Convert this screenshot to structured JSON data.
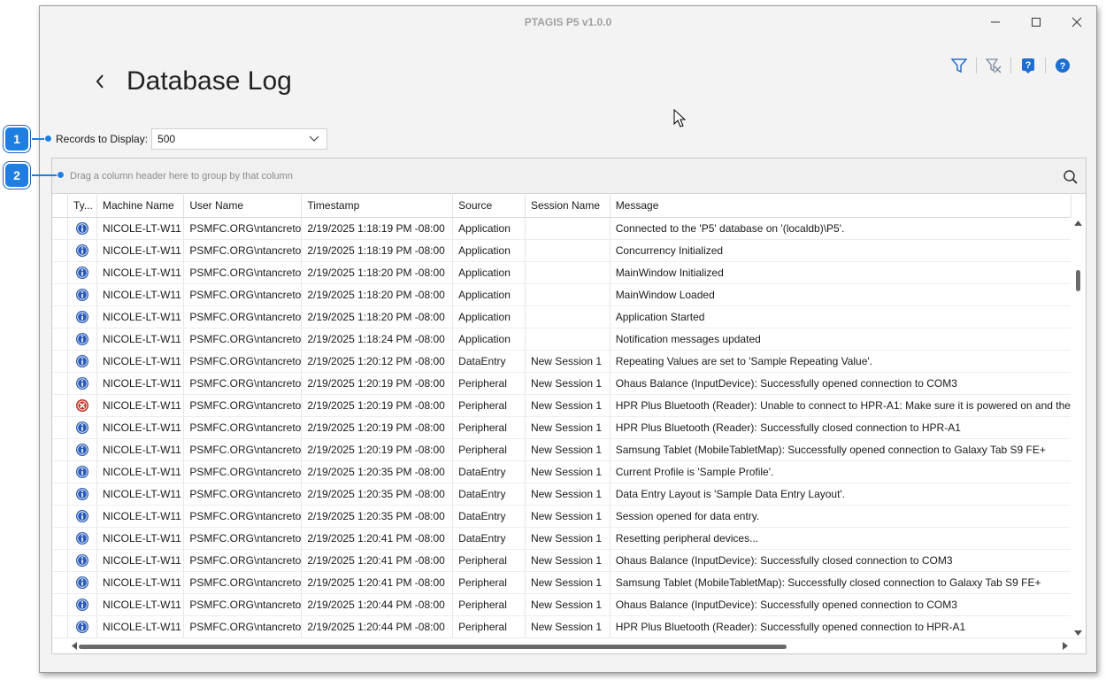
{
  "window": {
    "title": "PTAGIS P5 v1.0.0"
  },
  "page": {
    "title": "Database Log"
  },
  "records": {
    "label": "Records to Display:",
    "value": "500"
  },
  "grid": {
    "group_panel_text": "Drag a column header here to group by that column",
    "columns": [
      "Ty...",
      "Machine Name",
      "User Name",
      "Timestamp",
      "Source",
      "Session Name",
      "Message"
    ],
    "rows": [
      {
        "type": "info",
        "machine": "NICOLE-LT-W11",
        "user": "PSMFC.ORG\\ntancreto",
        "timestamp": "2/19/2025 1:18:19 PM -08:00",
        "source": "Application",
        "session": "",
        "message": "Connected to the 'P5' database on '(localdb)\\P5'."
      },
      {
        "type": "info",
        "machine": "NICOLE-LT-W11",
        "user": "PSMFC.ORG\\ntancreto",
        "timestamp": "2/19/2025 1:18:19 PM -08:00",
        "source": "Application",
        "session": "",
        "message": "Concurrency Initialized"
      },
      {
        "type": "info",
        "machine": "NICOLE-LT-W11",
        "user": "PSMFC.ORG\\ntancreto",
        "timestamp": "2/19/2025 1:18:20 PM -08:00",
        "source": "Application",
        "session": "",
        "message": "MainWindow Initialized"
      },
      {
        "type": "info",
        "machine": "NICOLE-LT-W11",
        "user": "PSMFC.ORG\\ntancreto",
        "timestamp": "2/19/2025 1:18:20 PM -08:00",
        "source": "Application",
        "session": "",
        "message": "MainWindow Loaded"
      },
      {
        "type": "info",
        "machine": "NICOLE-LT-W11",
        "user": "PSMFC.ORG\\ntancreto",
        "timestamp": "2/19/2025 1:18:20 PM -08:00",
        "source": "Application",
        "session": "",
        "message": "Application Started"
      },
      {
        "type": "info",
        "machine": "NICOLE-LT-W11",
        "user": "PSMFC.ORG\\ntancreto",
        "timestamp": "2/19/2025 1:18:24 PM -08:00",
        "source": "Application",
        "session": "",
        "message": "Notification messages updated"
      },
      {
        "type": "info",
        "machine": "NICOLE-LT-W11",
        "user": "PSMFC.ORG\\ntancreto",
        "timestamp": "2/19/2025 1:20:12 PM -08:00",
        "source": "DataEntry",
        "session": "New Session 1",
        "message": "Repeating Values are set to 'Sample Repeating Value'."
      },
      {
        "type": "info",
        "machine": "NICOLE-LT-W11",
        "user": "PSMFC.ORG\\ntancreto",
        "timestamp": "2/19/2025 1:20:19 PM -08:00",
        "source": "Peripheral",
        "session": "New Session 1",
        "message": "Ohaus Balance (InputDevice): Successfully opened connection to COM3"
      },
      {
        "type": "error",
        "machine": "NICOLE-LT-W11",
        "user": "PSMFC.ORG\\ntancreto",
        "timestamp": "2/19/2025 1:20:19 PM -08:00",
        "source": "Peripheral",
        "session": "New Session 1",
        "message": "HPR Plus Bluetooth (Reader): Unable to connect to HPR-A1: Make sure it is powered on and the"
      },
      {
        "type": "info",
        "machine": "NICOLE-LT-W11",
        "user": "PSMFC.ORG\\ntancreto",
        "timestamp": "2/19/2025 1:20:19 PM -08:00",
        "source": "Peripheral",
        "session": "New Session 1",
        "message": "HPR Plus Bluetooth (Reader): Successfully closed connection to HPR-A1"
      },
      {
        "type": "info",
        "machine": "NICOLE-LT-W11",
        "user": "PSMFC.ORG\\ntancreto",
        "timestamp": "2/19/2025 1:20:19 PM -08:00",
        "source": "Peripheral",
        "session": "New Session 1",
        "message": "Samsung Tablet (MobileTabletMap): Successfully opened connection to Galaxy Tab S9 FE+"
      },
      {
        "type": "info",
        "machine": "NICOLE-LT-W11",
        "user": "PSMFC.ORG\\ntancreto",
        "timestamp": "2/19/2025 1:20:35 PM -08:00",
        "source": "DataEntry",
        "session": "New Session 1",
        "message": "Current Profile is 'Sample Profile'."
      },
      {
        "type": "info",
        "machine": "NICOLE-LT-W11",
        "user": "PSMFC.ORG\\ntancreto",
        "timestamp": "2/19/2025 1:20:35 PM -08:00",
        "source": "DataEntry",
        "session": "New Session 1",
        "message": "Data Entry Layout is 'Sample Data Entry Layout'."
      },
      {
        "type": "info",
        "machine": "NICOLE-LT-W11",
        "user": "PSMFC.ORG\\ntancreto",
        "timestamp": "2/19/2025 1:20:35 PM -08:00",
        "source": "DataEntry",
        "session": "New Session 1",
        "message": "Session opened for data entry."
      },
      {
        "type": "info",
        "machine": "NICOLE-LT-W11",
        "user": "PSMFC.ORG\\ntancreto",
        "timestamp": "2/19/2025 1:20:41 PM -08:00",
        "source": "DataEntry",
        "session": "New Session 1",
        "message": "Resetting peripheral devices..."
      },
      {
        "type": "info",
        "machine": "NICOLE-LT-W11",
        "user": "PSMFC.ORG\\ntancreto",
        "timestamp": "2/19/2025 1:20:41 PM -08:00",
        "source": "Peripheral",
        "session": "New Session 1",
        "message": "Ohaus Balance (InputDevice): Successfully closed connection to COM3"
      },
      {
        "type": "info",
        "machine": "NICOLE-LT-W11",
        "user": "PSMFC.ORG\\ntancreto",
        "timestamp": "2/19/2025 1:20:41 PM -08:00",
        "source": "Peripheral",
        "session": "New Session 1",
        "message": "Samsung Tablet (MobileTabletMap): Successfully closed connection to Galaxy Tab S9 FE+"
      },
      {
        "type": "info",
        "machine": "NICOLE-LT-W11",
        "user": "PSMFC.ORG\\ntancreto",
        "timestamp": "2/19/2025 1:20:44 PM -08:00",
        "source": "Peripheral",
        "session": "New Session 1",
        "message": "Ohaus Balance (InputDevice): Successfully opened connection to COM3"
      },
      {
        "type": "info",
        "machine": "NICOLE-LT-W11",
        "user": "PSMFC.ORG\\ntancreto",
        "timestamp": "2/19/2025 1:20:44 PM -08:00",
        "source": "Peripheral",
        "session": "New Session 1",
        "message": "HPR Plus Bluetooth (Reader): Successfully opened connection to HPR-A1"
      }
    ]
  },
  "callouts": [
    "1",
    "2"
  ],
  "colors": {
    "accent": "#1e7fe0",
    "info_icon": "#2a5bb5",
    "error_icon": "#c0392b"
  }
}
